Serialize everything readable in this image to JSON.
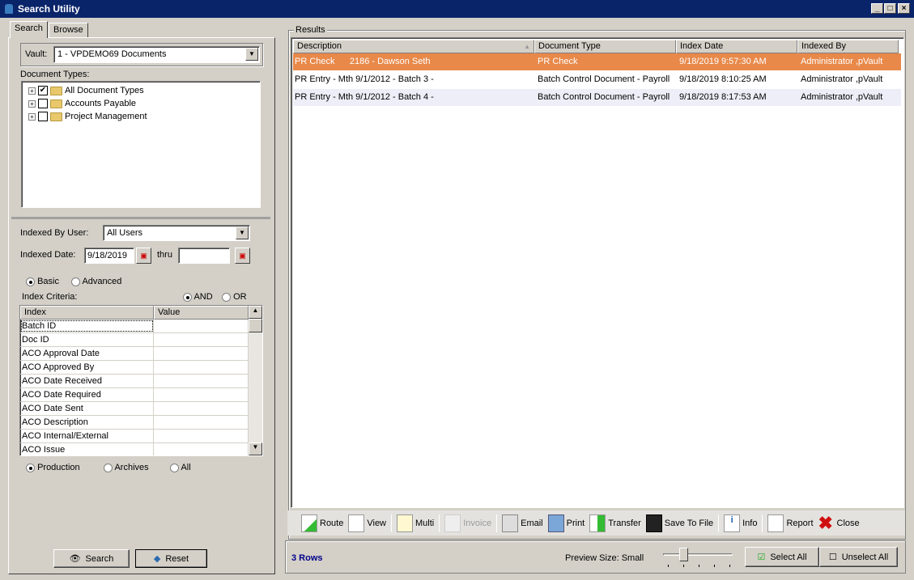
{
  "window": {
    "title": "Search Utility"
  },
  "tabs": [
    {
      "label": "Search"
    },
    {
      "label": "Browse"
    }
  ],
  "search": {
    "vault_label": "Vault:",
    "vault_value": "1 - VPDEMO69 Documents",
    "doc_types_label": "Document Types:",
    "doc_types": [
      {
        "label": "All Document Types",
        "checked": true
      },
      {
        "label": "Accounts Payable",
        "checked": false
      },
      {
        "label": "Project Management",
        "checked": false
      }
    ],
    "indexed_by_label": "Indexed By User:",
    "indexed_by_value": "All Users",
    "indexed_date_label": "Indexed Date:",
    "indexed_date_from": "9/18/2019",
    "thru_label": "thru",
    "indexed_date_to": "",
    "mode_basic": "Basic",
    "mode_advanced": "Advanced",
    "mode_selected": "Basic",
    "criteria_label": "Index Criteria:",
    "and_label": "AND",
    "or_label": "OR",
    "logic_selected": "AND",
    "grid_headers": [
      "Index",
      "Value"
    ],
    "grid_rows": [
      "Batch ID",
      "Doc ID",
      "ACO Approval Date",
      "ACO Approved By",
      "ACO Date Received",
      "ACO Date Required",
      "ACO Date Sent",
      "ACO Description",
      "ACO Internal/External",
      "ACO Issue"
    ],
    "scope_production": "Production",
    "scope_archives": "Archives",
    "scope_all": "All",
    "scope_selected": "Production",
    "search_button": "Search",
    "reset_button": "Reset"
  },
  "results": {
    "group_label": "Results",
    "columns": [
      "Description",
      "Document Type",
      "Index Date",
      "Indexed By"
    ],
    "rows": [
      {
        "description": "PR Check      2186 - Dawson Seth",
        "doc_type": "PR Check",
        "index_date": "9/18/2019 9:57:30 AM",
        "indexed_by": "Administrator ,pVault",
        "selected": true
      },
      {
        "description": "PR Entry - Mth 9/1/2012 - Batch 3 -",
        "doc_type": "Batch Control Document - Payroll",
        "index_date": "9/18/2019 8:10:25 AM",
        "indexed_by": "Administrator ,pVault",
        "selected": false
      },
      {
        "description": "PR Entry - Mth 9/1/2012 - Batch 4 -",
        "doc_type": "Batch Control Document - Payroll",
        "index_date": "9/18/2019 8:17:53 AM",
        "indexed_by": "Administrator ,pVault",
        "selected": false
      }
    ],
    "selected_color": "#e8894a"
  },
  "toolbar": {
    "route": "Route",
    "view": "View",
    "multi": "Multi",
    "invoice": "Invoice",
    "email": "Email",
    "print": "Print",
    "transfer": "Transfer",
    "save": "Save To File",
    "info": "Info",
    "report": "Report",
    "close": "Close"
  },
  "status": {
    "rows": "3 Rows",
    "preview_label": "Preview Size: Small",
    "preview_level": 1,
    "preview_max": 4,
    "select_all": "Select All",
    "unselect_all": "Unselect All"
  }
}
